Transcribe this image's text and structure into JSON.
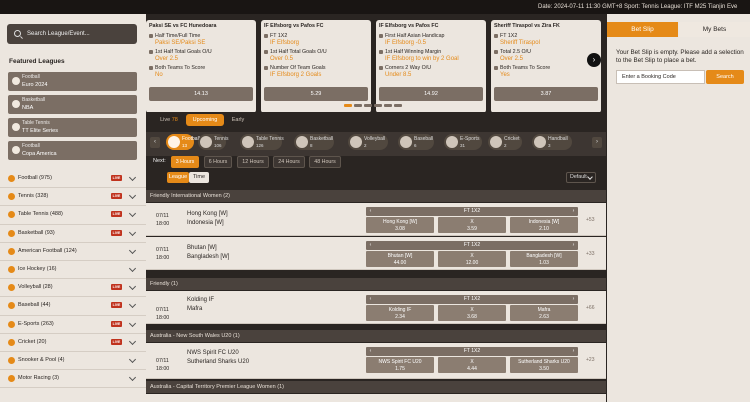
{
  "topbar": {
    "text": "Date: 2024-07-11 11:30 GMT+8 Sport: Tennis League: ITF M25 Tianjin Eve"
  },
  "left": {
    "search_placeholder": "Search League/Event...",
    "featured_title": "Featured Leagues",
    "featured": [
      {
        "sport": "Football",
        "league": "Euro 2024"
      },
      {
        "sport": "Basketball",
        "league": "NBA"
      },
      {
        "sport": "Table Tennis",
        "league": "TT Elite Series"
      },
      {
        "sport": "Football",
        "league": "Copa America"
      }
    ],
    "sports": [
      {
        "label": "Football  (975)",
        "live": "LIVE"
      },
      {
        "label": "Tennis  (328)",
        "live": "LIVE"
      },
      {
        "label": "Table Tennis  (488)",
        "live": "LIVE"
      },
      {
        "label": "Basketball  (93)",
        "live": "LIVE"
      },
      {
        "label": "American Football  (124)",
        "live": ""
      },
      {
        "label": "Ice Hockey  (16)",
        "live": ""
      },
      {
        "label": "Volleyball  (28)",
        "live": "LIVE"
      },
      {
        "label": "Baseball  (44)",
        "live": "LIVE"
      },
      {
        "label": "E-Sports  (263)",
        "live": "LIVE"
      },
      {
        "label": "Cricket  (20)",
        "live": "LIVE"
      },
      {
        "label": "Snooker & Pool  (4)",
        "live": ""
      },
      {
        "label": "Motor Racing  (3)",
        "live": ""
      }
    ]
  },
  "carousel": [
    {
      "title": "Paksi SE vs FC Hunedoara",
      "l1": "Half Time/Full Time",
      "l2": "Paksi SE/Paksi SE",
      "l3": "1st Half Total Goals O/U",
      "l4": "Over 2.5",
      "l5": "Both Teams To Score",
      "l6": "No",
      "price": "14.13"
    },
    {
      "title": "IF Elfsborg vs Pafos FC",
      "l1": "FT 1X2",
      "l2": "IF Elfsborg",
      "l3": "1st Half Total Goals O/U",
      "l4": "Over 0.5",
      "l5": "Number Of Team Goals",
      "l6": "IF Elfsborg 2 Goals",
      "price": "5.29"
    },
    {
      "title": "IF Elfsborg vs Pafos FC",
      "l1": "First Half Asian Handicap",
      "l2": "IF Elfsborg -0.5",
      "l3": "1st Half Winning Margin",
      "l4": "IF Elfsborg to win by 2 Goal",
      "l5": "Corners 2 Way O/U",
      "l6": "Under 8.5",
      "price": "14.92"
    },
    {
      "title": "Sheriff Tiraspol vs Zira FK",
      "l1": "FT 1X2",
      "l2": "Sheriff Tiraspol",
      "l3": "Total 2.5 O/U",
      "l4": "Over 2.5",
      "l5": "Both Teams To Score",
      "l6": "Yes",
      "price": "3.87"
    }
  ],
  "tabs": {
    "live": "Live",
    "live_count": "78",
    "upcoming": "Upcoming",
    "early": "Early"
  },
  "sport_chips": [
    {
      "name": "Football",
      "count": "13"
    },
    {
      "name": "Tennis",
      "count": "106"
    },
    {
      "name": "Table Tennis",
      "count": "126"
    },
    {
      "name": "Basketball",
      "count": "8"
    },
    {
      "name": "Volleyball",
      "count": "2"
    },
    {
      "name": "Baseball",
      "count": "6"
    },
    {
      "name": "E-Sports",
      "count": "31"
    },
    {
      "name": "Cricket",
      "count": "2"
    },
    {
      "name": "Handball",
      "count": "3"
    }
  ],
  "next": {
    "label": "Next:",
    "options": [
      "3 Hours",
      "6 Hours",
      "12 Hours",
      "24 Hours",
      "48 Hours"
    ]
  },
  "sort": {
    "league": "League",
    "time": "Time",
    "default": "Default"
  },
  "groups": [
    {
      "league": "Friendly International Women (2)"
    },
    {
      "league": "Friendly (1)"
    },
    {
      "league": "Australia - New South Wales U20 (1)"
    },
    {
      "league": "Australia - Capital Territory Premier League Women (1)"
    }
  ],
  "matches": [
    {
      "date": "07/11",
      "time": "18:00",
      "home": "Hong Kong [W]",
      "away": "Indonesia [W]",
      "market": "FT 1X2",
      "o1n": "Hong Kong [W]",
      "o1": "3.08",
      "oxn": "X",
      "ox": "3.59",
      "o2n": "Indonesia [W]",
      "o2": "2.10",
      "more": "+53"
    },
    {
      "date": "07/11",
      "time": "18:00",
      "home": "Bhutan [W]",
      "away": "Bangladesh [W]",
      "market": "FT 1X2",
      "o1n": "Bhutan [W]",
      "o1": "44.00",
      "oxn": "X",
      "ox": "12.00",
      "o2n": "Bangladesh [W]",
      "o2": "1.03",
      "more": "+33"
    },
    {
      "date": "07/11",
      "time": "18:00",
      "home": "Kolding IF",
      "away": "Mafra",
      "market": "FT 1X2",
      "o1n": "Kolding IF",
      "o1": "2.34",
      "oxn": "X",
      "ox": "3.68",
      "o2n": "Mafra",
      "o2": "2.63",
      "more": "+66"
    },
    {
      "date": "07/11",
      "time": "18:00",
      "home": "NWS Spirit FC U20",
      "away": "Sutherland Sharks U20",
      "market": "FT 1X2",
      "o1n": "NWS Spirit FC U20",
      "o1": "1.75",
      "oxn": "X",
      "ox": "4.44",
      "o2n": "Sutherland Sharks U20",
      "o2": "3.50",
      "more": "+23"
    }
  ],
  "betslip": {
    "tab1": "Bet Slip",
    "tab2": "My Bets",
    "message": "Your Bet Slip is empty. Please add a selection to the Bet Slip to place a bet.",
    "booking_placeholder": "Enter a Booking Code",
    "search_btn": "Search"
  },
  "colors": {
    "accent": "#e58a18",
    "dark": "#2a2522",
    "panel": "#ece6df",
    "live": "#c0321d"
  }
}
